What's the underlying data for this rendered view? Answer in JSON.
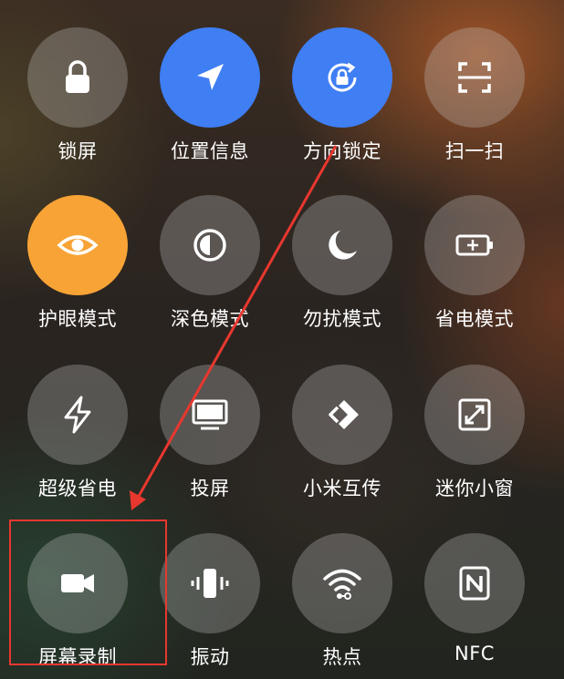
{
  "tiles": [
    {
      "label": "锁屏",
      "icon": "lock-icon",
      "state": "off"
    },
    {
      "label": "位置信息",
      "icon": "location-arrow-icon",
      "state": "on",
      "color": "#3f7ef3"
    },
    {
      "label": "方向锁定",
      "icon": "rotation-lock-icon",
      "state": "on",
      "color": "#3f7ef3"
    },
    {
      "label": "扫一扫",
      "icon": "scan-icon",
      "state": "off"
    },
    {
      "label": "护眼模式",
      "icon": "eye-icon",
      "state": "on",
      "color": "#f7a336"
    },
    {
      "label": "深色模式",
      "icon": "dark-mode-icon",
      "state": "off"
    },
    {
      "label": "勿扰模式",
      "icon": "moon-icon",
      "state": "off"
    },
    {
      "label": "省电模式",
      "icon": "battery-icon",
      "state": "off"
    },
    {
      "label": "超级省电",
      "icon": "lightning-icon",
      "state": "off"
    },
    {
      "label": "投屏",
      "icon": "screen-cast-icon",
      "state": "off"
    },
    {
      "label": "小米互传",
      "icon": "mi-share-icon",
      "state": "off"
    },
    {
      "label": "迷你小窗",
      "icon": "mini-window-icon",
      "state": "off"
    },
    {
      "label": "屏幕录制",
      "icon": "video-camera-icon",
      "state": "off",
      "highlighted": true
    },
    {
      "label": "振动",
      "icon": "vibrate-icon",
      "state": "off"
    },
    {
      "label": "热点",
      "icon": "hotspot-icon",
      "state": "off"
    },
    {
      "label": "NFC",
      "icon": "nfc-icon",
      "state": "off"
    }
  ],
  "annotation": {
    "color": "#e8372f",
    "arrow_from": "方向锁定",
    "arrow_to": "屏幕录制"
  }
}
